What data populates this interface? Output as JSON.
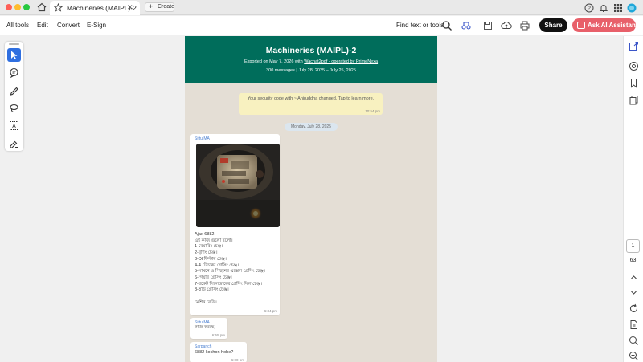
{
  "window": {
    "tab_title": "Machineries (MAIPL)-2",
    "create_label": "Create"
  },
  "menu": {
    "items": [
      "All tools",
      "Edit",
      "Convert",
      "E-Sign"
    ],
    "find_label": "Find text or tools",
    "share_label": "Share",
    "ai_label": "Ask AI Assistant"
  },
  "colors": {
    "header_green": "#006d5b",
    "ai_button": "#e8606a",
    "active_tool": "#2f6fe0",
    "chat_bg": "#e4ded5"
  },
  "document": {
    "header": {
      "title": "Machineries (MAIPL)-2",
      "exported_prefix": "Exported on May 7, 2026 with ",
      "exported_link": "Wachat2pdf - operated by PrimeNexa",
      "summary": "300 messages | July 28, 2025 – July 25, 2025"
    },
    "system_message": {
      "text": "Your security code with ~ Aniruddha changed. Tap to learn more.",
      "time": "10:54 pm"
    },
    "date_divider": "Monday, July 28, 2025",
    "messages": [
      {
        "sender": "Sittu MA",
        "lines": [
          "Ajax 6882",
          "এই কাজ গুলো হলো।",
          "1-বেয়ারিং চেঞ্জ।",
          "2-বুশিং চেঞ্জ।",
          "3-Dl ফিল্টার চেঞ্জ।",
          "4-4 টে চাকা গ্রেসিং চেঞ্জ।",
          "5-সামনে ও পিছনের এক্সেল গ্রেসিং চেঞ্জ।",
          "6-গিয়ার গ্রেসিং চেঞ্জ।",
          "7-বকেট সিলেন্ডারের গ্রেসিং সিল চেঞ্জ।",
          "8-হুড়ি গ্রেসিং চেঞ্জ।",
          "",
          "মেশিন রেডি।"
        ],
        "time": "6:34 pm"
      },
      {
        "sender": "Sittu MA",
        "lines": [
          "কাজ করছে।"
        ],
        "time": "6:55 pm"
      },
      {
        "sender": "Sarpanch",
        "lines": [
          "6882 kokhon hobe?"
        ],
        "time": "6:00 pm"
      }
    ]
  },
  "pagination": {
    "current_page": "1",
    "total_pages": "63"
  },
  "icons": {
    "titlebar": [
      "home-icon",
      "star-icon",
      "close-icon",
      "help-icon",
      "bell-icon",
      "apps-icon",
      "profile-icon"
    ],
    "menubar": [
      "search-icon",
      "compare-icon",
      "save-icon",
      "upload-icon",
      "print-icon"
    ],
    "tools": [
      "select-icon",
      "comment-icon",
      "pen-icon",
      "lasso-icon",
      "text-box-icon",
      "fill-sign-icon"
    ],
    "rightbar": [
      "export-icon",
      "ai-chat-icon",
      "bookmark-icon",
      "pages-icon",
      "chevron-up-icon",
      "chevron-down-icon",
      "refresh-icon",
      "document-icon",
      "zoom-in-icon",
      "zoom-out-icon"
    ]
  }
}
